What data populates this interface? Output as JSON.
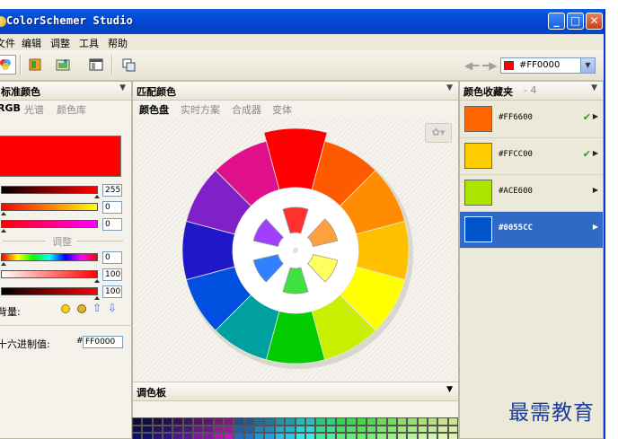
{
  "window": {
    "title": "ColorSchemer Studio"
  },
  "menu": [
    "文件",
    "编辑",
    "调整",
    "工具",
    "帮助"
  ],
  "toolbar": {
    "icons": [
      "color-wheel-icon",
      "swatch-book-icon",
      "image-picker-icon",
      "window-icon",
      "layers-icon"
    ],
    "current_color": "#FF0000"
  },
  "left_panel": {
    "title": "标准颜色",
    "tabs": [
      "RGB",
      "光谱",
      "颜色库"
    ],
    "active_tab": "RGB",
    "color": "#ff0000",
    "rgb_values": [
      "255",
      "0",
      "0"
    ],
    "adjust_label": "调整",
    "adjust_values": [
      "0",
      "100",
      "100"
    ],
    "brightness_label": "背量:",
    "hex_label": "十六进制值:",
    "hex_prefix": "#",
    "hex_value": "FF0000"
  },
  "center_panel": {
    "title": "匹配颜色",
    "tabs": [
      "颜色盘",
      "实时方案",
      "合成器",
      "变体"
    ],
    "active_tab": "颜色盘",
    "wheel_colors": [
      "#ff0000",
      "#ff5a00",
      "#ff8c00",
      "#ffc000",
      "#ffff00",
      "#c8f000",
      "#00cc00",
      "#00a0a0",
      "#0050e0",
      "#2018c8",
      "#8020c8",
      "#e0108c"
    ],
    "inner_colors": [
      "#ff3030",
      "#ffa040",
      "#ffff60",
      "#40e040",
      "#3080ff",
      "#a040ff"
    ],
    "palette_title": "调色板"
  },
  "right_panel": {
    "title": "颜色收藏夹",
    "count": "- 4",
    "favorites": [
      {
        "code": "#FF6600",
        "color": "#ff6600",
        "checked": true,
        "selected": false
      },
      {
        "code": "#FFCC00",
        "color": "#ffcc00",
        "checked": true,
        "selected": false
      },
      {
        "code": "#ACE600",
        "color": "#ace600",
        "checked": false,
        "selected": false
      },
      {
        "code": "#0055CC",
        "color": "#0055cc",
        "checked": false,
        "selected": true
      }
    ]
  },
  "watermark": "最需教育"
}
